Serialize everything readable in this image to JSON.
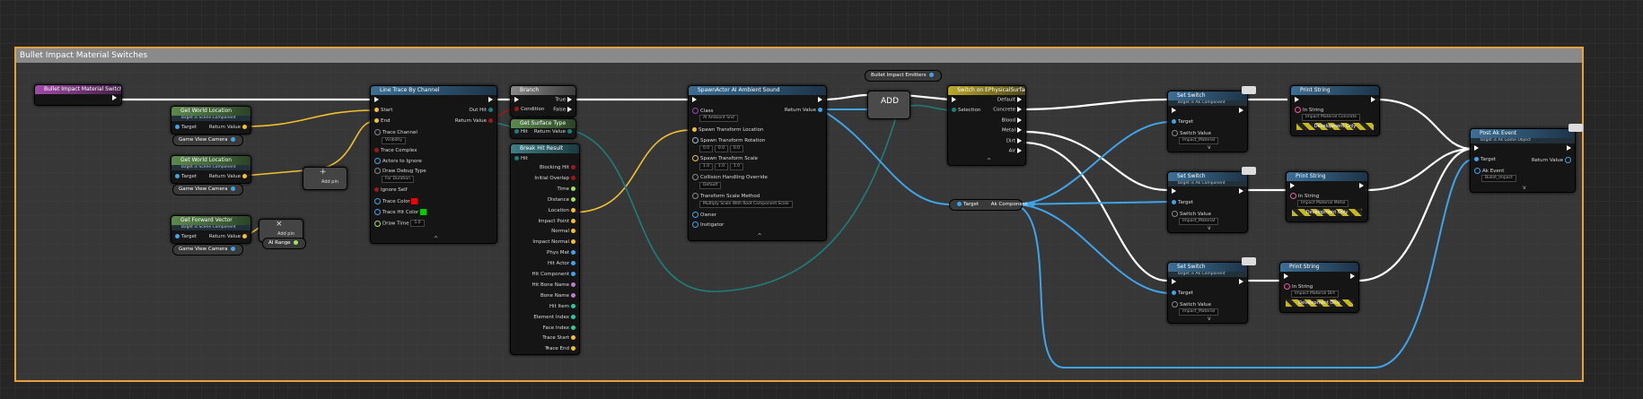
{
  "comment": {
    "title": "Bullet Impact Material Switches"
  },
  "colors": {
    "exec": "#ffffff",
    "vector": "#f2c12e",
    "object": "#3fa5ea",
    "bool": "#9a1a1a",
    "struct": "#1c7f7a",
    "float": "#9ee35a",
    "accent": "#e8a13a"
  },
  "event_node": {
    "title": "Bullet Impact Material Switches"
  },
  "world_loc_1": {
    "title": "Get World Location",
    "sub": "Target is Scene Component",
    "target": "Target",
    "return": "Return Value",
    "getter": "Game View Camera"
  },
  "world_loc_2": {
    "title": "Get World Location",
    "sub": "Target is Scene Component",
    "target": "Target",
    "return": "Return Value",
    "getter": "Game View Camera"
  },
  "forward_vec": {
    "title": "Get Forward Vector",
    "sub": "Target is Scene Component",
    "target": "Target",
    "return": "Return Value",
    "getter": "Game View Camera"
  },
  "add_pin_1": {
    "label": "Add pin"
  },
  "add_pin_2": {
    "label": "Add pin"
  },
  "ai_range": {
    "label": "AI Range"
  },
  "line_trace": {
    "title": "Line Trace By Channel",
    "start": "Start",
    "end": "End",
    "trace_channel": "Trace Channel",
    "channel_value": "Visibility",
    "trace_complex": "Trace Complex",
    "actors_ignore": "Actors to Ignore",
    "draw_debug": "Draw Debug Type",
    "debug_value": "For Duration",
    "ignore_self": "Ignore Self",
    "trace_color": "Trace Color",
    "trace_hit_color": "Trace Hit Color",
    "draw_time": "Draw Time",
    "draw_time_value": "5.0",
    "out_hit": "Out Hit",
    "return": "Return Value"
  },
  "branch": {
    "title": "Branch",
    "condition": "Condition",
    "true": "True",
    "false": "False"
  },
  "surface_type": {
    "title": "Get Surface Type",
    "hit": "Hit",
    "return": "Return Value"
  },
  "break_hit": {
    "title": "Break Hit Result",
    "hit": "Hit",
    "pins": [
      "Blocking Hit",
      "Initial Overlap",
      "Time",
      "Distance",
      "Location",
      "Impact Point",
      "Normal",
      "Impact Normal",
      "Phys Mat",
      "Hit Actor",
      "Hit Component",
      "Hit Bone Name",
      "Bone Name",
      "Hit Item",
      "Element Index",
      "Face Index",
      "Trace Start",
      "Trace End"
    ]
  },
  "spawn": {
    "title": "SpawnActor AI Ambient Sound",
    "class": "Class",
    "class_value": "AI Ambient Snd",
    "return": "Return Value",
    "stl": "Spawn Transform Location",
    "str": "Spawn Transform Rotation",
    "rot_values": [
      "0.0",
      "0.0",
      "0.0"
    ],
    "sts": "Spawn Transform Scale",
    "scale_values": [
      "1.0",
      "1.0",
      "1.0"
    ],
    "collision": "Collision Handling Override",
    "collision_value": "Default",
    "tsm": "Transform Scale Method",
    "tsm_value": "Multiply Scale With Root Component Scale",
    "owner": "Owner",
    "instigator": "Instigator"
  },
  "emitters_var": {
    "label": "Bullet Impact Emitters"
  },
  "add_node": {
    "label": "ADD"
  },
  "switch_phys": {
    "title": "Switch on EPhysicalSurface",
    "selection": "Selection",
    "outputs": [
      "Default",
      "Concrete",
      "Blood",
      "Metal",
      "Dirt",
      "Air"
    ]
  },
  "ak_comp": {
    "target": "Target",
    "label": "Ak Component"
  },
  "set_switch_1": {
    "title": "Set Switch",
    "sub": "Target is Ak Component",
    "target": "Target",
    "switch": "Switch Value",
    "value": "Impact_Material"
  },
  "set_switch_2": {
    "title": "Set Switch",
    "sub": "Target is Ak Component",
    "target": "Target",
    "switch": "Switch Value",
    "value": "Impact_Material"
  },
  "set_switch_3": {
    "title": "Set Switch",
    "sub": "Target is Ak Component",
    "target": "Target",
    "switch": "Switch Value",
    "value": "Impact_Material"
  },
  "print_1": {
    "title": "Print String",
    "in_string": "In String",
    "value": "Impact Material Concrete",
    "dev": "Development Only"
  },
  "print_2": {
    "title": "Print String",
    "in_string": "In String",
    "value": "Impact Material Metal",
    "dev": "Development Only"
  },
  "print_3": {
    "title": "Print String",
    "in_string": "In String",
    "value": "Impact Material Dirt",
    "dev": "Development Only"
  },
  "post_event": {
    "title": "Post Ak Event",
    "sub": "Target is Ak Game Object",
    "target": "Target",
    "ak_event": "Ak Event",
    "event_value": "Bullet_Impact",
    "return": "Return Value"
  }
}
